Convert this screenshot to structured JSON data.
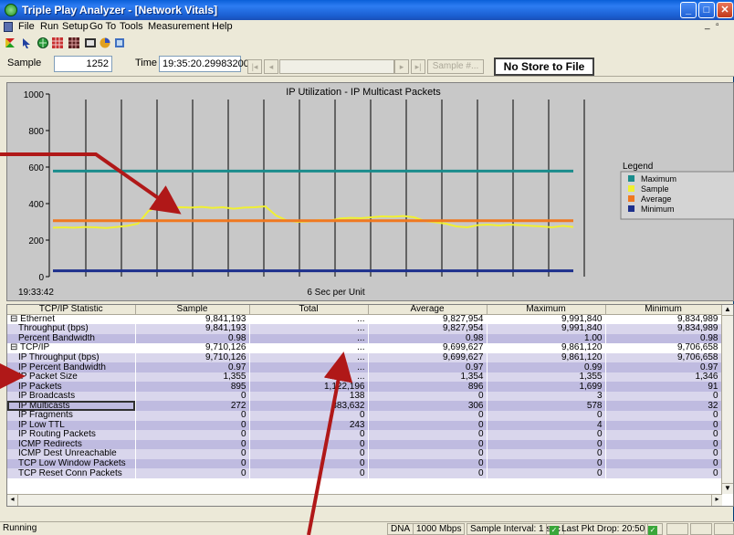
{
  "window": {
    "title": "Triple Play Analyzer - [Network Vitals]"
  },
  "menu": [
    "File",
    "Run",
    "Setup",
    "Go To",
    "Tools",
    "Measurement",
    "Help"
  ],
  "sample_bar": {
    "sample_label": "Sample",
    "sample_value": "1252",
    "time_label": "Time",
    "time_value": "19:35:20.299832000",
    "sample_num_button": "Sample #...",
    "store_label": "No Store to File"
  },
  "chart_data": {
    "type": "line",
    "title": "IP Utilization - IP Multicast Packets",
    "xlabel": "6 Sec per Unit",
    "x_start_label": "19:33:42",
    "ylim": [
      0,
      1000
    ],
    "y_ticks": [
      "0",
      "200",
      "400",
      "600",
      "800",
      "1000"
    ],
    "grid": "vertical",
    "legend_title": "Legend",
    "legend_position": "right",
    "series": [
      {
        "name": "Maximum",
        "color": "#1a8c8c",
        "values": [
          578,
          578,
          578,
          578,
          578,
          578,
          578,
          578,
          578,
          578,
          578,
          578,
          578,
          578,
          578,
          578,
          578,
          578,
          578,
          578,
          578,
          578,
          578,
          578,
          578,
          578,
          578,
          578,
          578,
          578,
          578,
          578,
          578,
          578,
          578,
          578,
          578,
          578,
          578,
          578,
          578,
          578,
          578,
          578,
          578,
          578,
          578,
          578,
          578,
          578
        ]
      },
      {
        "name": "Sample",
        "color": "#f0f032",
        "values": [
          268,
          270,
          268,
          272,
          270,
          266,
          272,
          278,
          290,
          360,
          385,
          375,
          380,
          378,
          382,
          376,
          380,
          372,
          378,
          380,
          385,
          335,
          308,
          300,
          302,
          310,
          305,
          318,
          322,
          320,
          325,
          330,
          328,
          332,
          325,
          305,
          298,
          290,
          275,
          270,
          282,
          285,
          280,
          285,
          282,
          278,
          275,
          270,
          278,
          272
        ]
      },
      {
        "name": "Average",
        "color": "#f07820",
        "values": [
          306,
          306,
          306,
          306,
          306,
          306,
          306,
          306,
          306,
          306,
          306,
          306,
          306,
          306,
          306,
          306,
          306,
          306,
          306,
          306,
          306,
          306,
          306,
          306,
          306,
          306,
          306,
          306,
          306,
          306,
          306,
          306,
          306,
          306,
          306,
          306,
          306,
          306,
          306,
          306,
          306,
          306,
          306,
          306,
          306,
          306,
          306,
          306,
          306,
          306
        ]
      },
      {
        "name": "Minimum",
        "color": "#1c2f8c",
        "values": [
          32,
          32,
          32,
          32,
          32,
          32,
          32,
          32,
          32,
          32,
          32,
          32,
          32,
          32,
          32,
          32,
          32,
          32,
          32,
          32,
          32,
          32,
          32,
          32,
          32,
          32,
          32,
          32,
          32,
          32,
          32,
          32,
          32,
          32,
          32,
          32,
          32,
          32,
          32,
          32,
          32,
          32,
          32,
          32,
          32,
          32,
          32,
          32,
          32,
          32
        ]
      }
    ]
  },
  "table": {
    "columns": [
      "TCP/IP Statistic",
      "Sample",
      "Total",
      "Average",
      "Maximum",
      "Minimum"
    ],
    "rows": [
      {
        "name": "Ethernet",
        "group": true,
        "cells": [
          "9,841,193",
          "...",
          "9,827,954",
          "9,991,840",
          "9,834,989"
        ]
      },
      {
        "name": "Throughput (bps)",
        "cells": [
          "9,841,193",
          "...",
          "9,827,954",
          "9,991,840",
          "9,834,989"
        ]
      },
      {
        "name": "Percent Bandwidth",
        "cells": [
          "0.98",
          "...",
          "0.98",
          "1.00",
          "0.98"
        ]
      },
      {
        "name": "TCP/IP",
        "group": true,
        "cells": [
          "9,710,126",
          "...",
          "9,699,627",
          "9,861,120",
          "9,706,658"
        ]
      },
      {
        "name": "IP Throughput (bps)",
        "cells": [
          "9,710,126",
          "...",
          "9,699,627",
          "9,861,120",
          "9,706,658"
        ]
      },
      {
        "name": "IP Percent Bandwidth",
        "cells": [
          "0.97",
          "...",
          "0.97",
          "0.99",
          "0.97"
        ]
      },
      {
        "name": "IP Packet Size",
        "cells": [
          "1,355",
          "...",
          "1,354",
          "1,355",
          "1,346"
        ]
      },
      {
        "name": "IP Packets",
        "cells": [
          "895",
          "1,122,196",
          "896",
          "1,699",
          "91"
        ]
      },
      {
        "name": "IP Broadcasts",
        "cells": [
          "0",
          "138",
          "0",
          "3",
          "0"
        ]
      },
      {
        "name": "IP Multicasts",
        "selected": true,
        "cells": [
          "272",
          "383,632",
          "306",
          "578",
          "32"
        ]
      },
      {
        "name": "IP Fragments",
        "cells": [
          "0",
          "0",
          "0",
          "0",
          "0"
        ]
      },
      {
        "name": "IP Low TTL",
        "cells": [
          "0",
          "243",
          "0",
          "4",
          "0"
        ]
      },
      {
        "name": "IP Routing Packets",
        "cells": [
          "0",
          "0",
          "0",
          "0",
          "0"
        ]
      },
      {
        "name": "ICMP Redirects",
        "cells": [
          "0",
          "0",
          "0",
          "0",
          "0"
        ]
      },
      {
        "name": "ICMP Dest Unreachable",
        "cells": [
          "0",
          "0",
          "0",
          "0",
          "0"
        ]
      },
      {
        "name": "TCP Low Window Packets",
        "cells": [
          "0",
          "0",
          "0",
          "0",
          "0"
        ]
      },
      {
        "name": "TCP Reset Conn Packets",
        "cells": [
          "0",
          "0",
          "0",
          "0",
          "0"
        ]
      }
    ]
  },
  "status": {
    "state": "Running",
    "dna": "DNA",
    "speed": "1000 Mbps",
    "interval": "Sample Interval: 1 sec",
    "drop": "Last Pkt Drop: 20:50"
  }
}
